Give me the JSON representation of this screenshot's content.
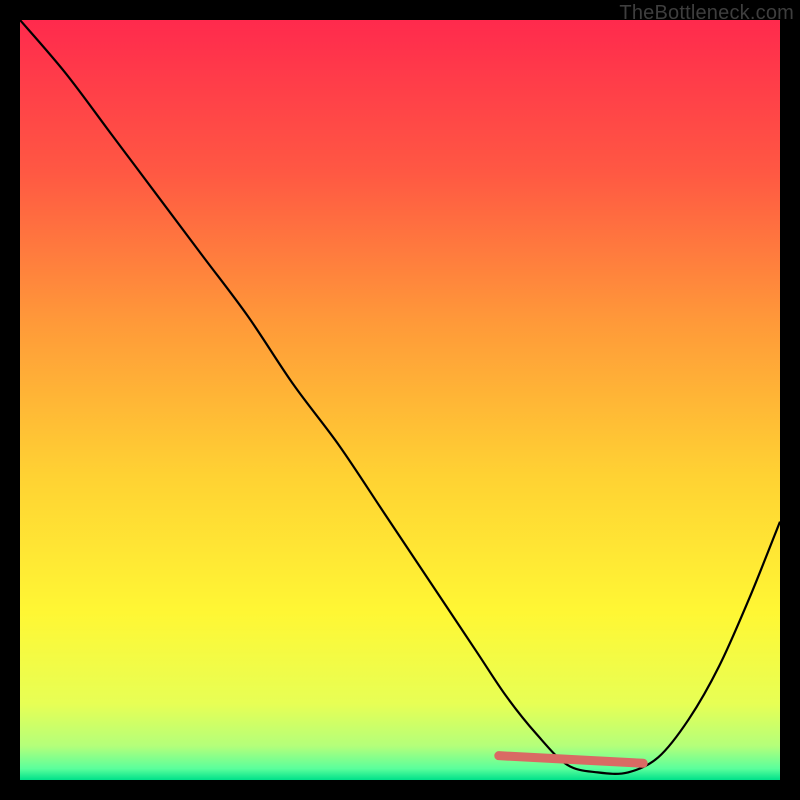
{
  "watermark": "TheBottleneck.com",
  "chart_data": {
    "type": "line",
    "title": "",
    "xlabel": "",
    "ylabel": "",
    "xlim": [
      0,
      100
    ],
    "ylim": [
      0,
      100
    ],
    "grid": false,
    "legend": false,
    "background_gradient_stops": [
      {
        "offset": 0.0,
        "color": "#ff2a4d"
      },
      {
        "offset": 0.2,
        "color": "#ff5843"
      },
      {
        "offset": 0.4,
        "color": "#ff9a39"
      },
      {
        "offset": 0.6,
        "color": "#ffd233"
      },
      {
        "offset": 0.78,
        "color": "#fff734"
      },
      {
        "offset": 0.9,
        "color": "#e7ff55"
      },
      {
        "offset": 0.955,
        "color": "#b4ff7a"
      },
      {
        "offset": 0.985,
        "color": "#5bff9c"
      },
      {
        "offset": 1.0,
        "color": "#00e08a"
      }
    ],
    "series": [
      {
        "name": "bottleneck-curve",
        "color": "#000000",
        "x": [
          0,
          6,
          12,
          18,
          24,
          30,
          36,
          42,
          48,
          54,
          60,
          64,
          68,
          72,
          76,
          80,
          84,
          88,
          92,
          96,
          100
        ],
        "values": [
          100,
          93,
          85,
          77,
          69,
          61,
          52,
          44,
          35,
          26,
          17,
          11,
          6,
          2,
          1,
          1,
          3,
          8,
          15,
          24,
          34
        ]
      }
    ],
    "annotations": [
      {
        "name": "bottleneck-band",
        "type": "segment",
        "color": "#d96a64",
        "width": 9,
        "x0": 63,
        "y0": 3.2,
        "x1": 82,
        "y1": 2.2
      }
    ]
  }
}
